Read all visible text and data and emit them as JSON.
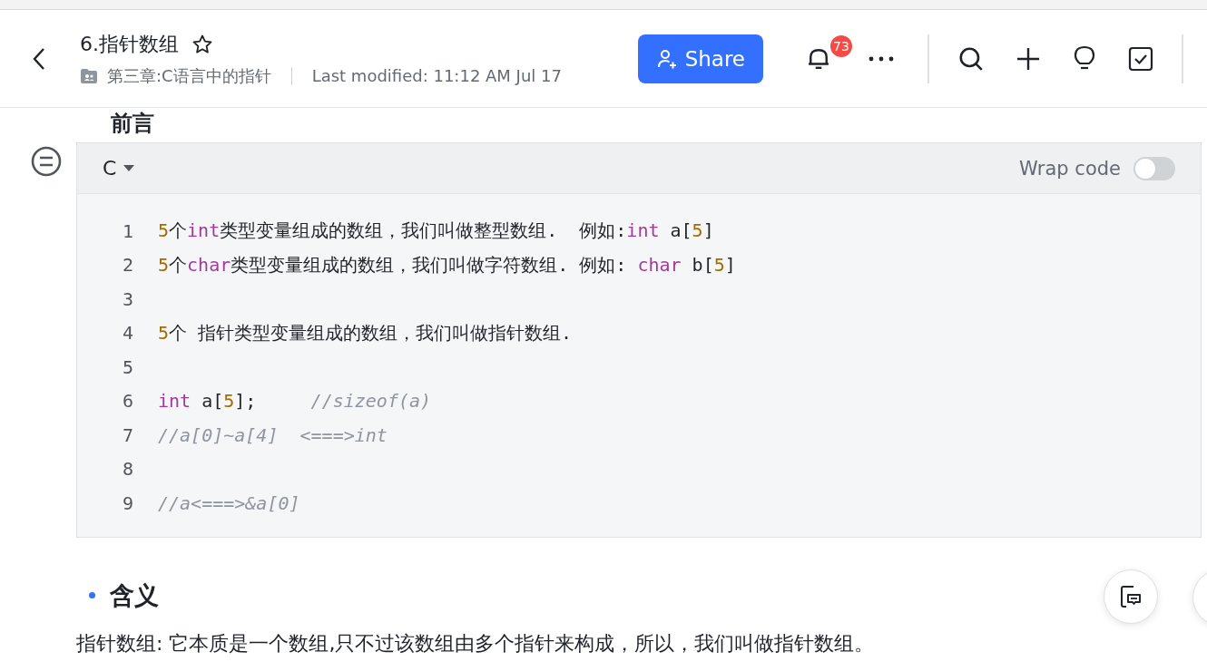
{
  "header": {
    "title": "6.指针数组",
    "starred": false,
    "folder": "第三章:C语言中的指针",
    "last_modified": "Last modified: 11:12 AM Jul 17",
    "share": "Share",
    "notifications": "73"
  },
  "heading": "前言",
  "code_block": {
    "language": "C",
    "wrap_label": "Wrap code",
    "wrap": false,
    "lines": [
      {
        "number": "1",
        "tokens": [
          {
            "kind": "num",
            "text": "5"
          },
          {
            "kind": "text",
            "text": "个"
          },
          {
            "kind": "kw",
            "text": "int"
          },
          {
            "kind": "text",
            "text": "类型变量组成的数组，我们叫做整型数组.  例如:"
          },
          {
            "kind": "kw",
            "text": "int"
          },
          {
            "kind": "text",
            "text": " a["
          },
          {
            "kind": "num",
            "text": "5"
          },
          {
            "kind": "text",
            "text": "]"
          }
        ]
      },
      {
        "number": "2",
        "tokens": [
          {
            "kind": "num",
            "text": "5"
          },
          {
            "kind": "text",
            "text": "个"
          },
          {
            "kind": "kw",
            "text": "char"
          },
          {
            "kind": "text",
            "text": "类型变量组成的数组，我们叫做字符数组. 例如: "
          },
          {
            "kind": "kw",
            "text": "char"
          },
          {
            "kind": "text",
            "text": " b["
          },
          {
            "kind": "num",
            "text": "5"
          },
          {
            "kind": "text",
            "text": "]"
          }
        ]
      },
      {
        "number": "3"
      },
      {
        "number": "4",
        "tokens": [
          {
            "kind": "num",
            "text": "5"
          },
          {
            "kind": "text",
            "text": "个 指针类型变量组成的数组，我们叫做指针数组."
          }
        ]
      },
      {
        "number": "5"
      },
      {
        "number": "6",
        "tokens": [
          {
            "kind": "kw",
            "text": "int"
          },
          {
            "kind": "text",
            "text": " a["
          },
          {
            "kind": "num",
            "text": "5"
          },
          {
            "kind": "text",
            "text": "];     "
          },
          {
            "kind": "comment",
            "text": "//sizeof(a)"
          }
        ]
      },
      {
        "number": "7",
        "tokens": [
          {
            "kind": "comment",
            "text": "//a[0]~a[4]  <===>int"
          }
        ]
      },
      {
        "number": "8"
      },
      {
        "number": "9",
        "tokens": [
          {
            "kind": "comment",
            "text": "//a<===>&a[0]"
          }
        ]
      }
    ]
  },
  "section": {
    "title": "含义",
    "paragraph": "指针数组: 它本质是一个数组,只不过该数组由多个指针来构成，所以，我们叫做指针数组。"
  }
}
